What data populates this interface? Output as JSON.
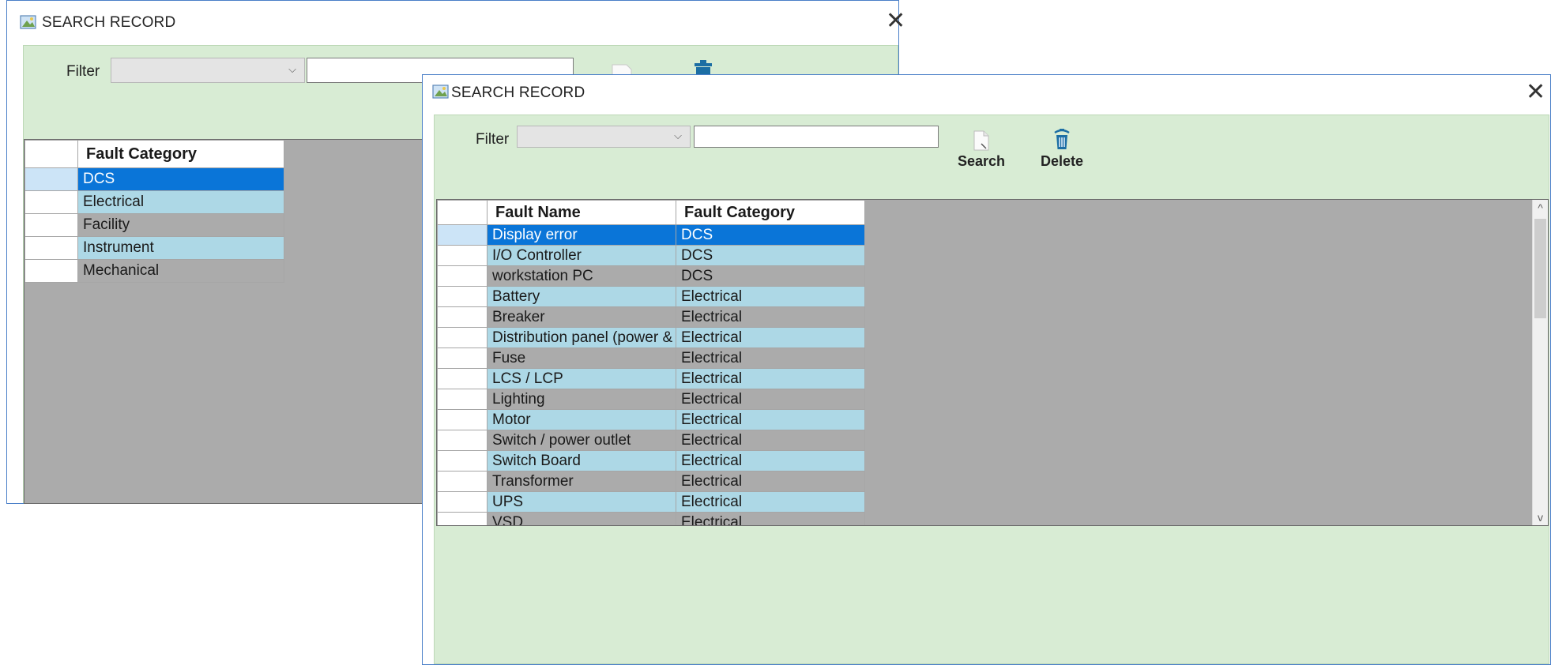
{
  "back_window": {
    "title": "SEARCH RECORD",
    "close_glyph": "✕",
    "filter_label": "Filter",
    "filter_select_value": "",
    "filter_text_value": "",
    "dropdown_glyph": "⌵",
    "grid": {
      "columns": [
        "Fault Category"
      ],
      "rows": [
        {
          "cells": [
            "DCS"
          ],
          "style": "sel"
        },
        {
          "cells": [
            "Electrical"
          ],
          "style": "alt"
        },
        {
          "cells": [
            "Facility"
          ],
          "style": "norm"
        },
        {
          "cells": [
            "Instrument"
          ],
          "style": "alt"
        },
        {
          "cells": [
            "Mechanical"
          ],
          "style": "norm"
        }
      ]
    }
  },
  "front_window": {
    "title": "SEARCH RECORD",
    "close_glyph": "✕",
    "filter_label": "Filter",
    "filter_select_value": "",
    "filter_text_value": "",
    "dropdown_glyph": "⌵",
    "search_label": "Search",
    "delete_label": "Delete",
    "scroll_up_glyph": "^",
    "scroll_down_glyph": "v",
    "grid": {
      "columns": [
        "Fault Name",
        "Fault Category"
      ],
      "rows": [
        {
          "cells": [
            "Display error",
            "DCS"
          ],
          "style": "sel"
        },
        {
          "cells": [
            "I/O Controller",
            "DCS"
          ],
          "style": "alt"
        },
        {
          "cells": [
            "workstation PC",
            "DCS"
          ],
          "style": "norm"
        },
        {
          "cells": [
            "Battery",
            "Electrical"
          ],
          "style": "alt"
        },
        {
          "cells": [
            "Breaker",
            "Electrical"
          ],
          "style": "norm"
        },
        {
          "cells": [
            "Distribution panel (power &",
            "Electrical"
          ],
          "style": "alt"
        },
        {
          "cells": [
            "Fuse",
            "Electrical"
          ],
          "style": "norm"
        },
        {
          "cells": [
            "LCS / LCP",
            "Electrical"
          ],
          "style": "alt"
        },
        {
          "cells": [
            "Lighting",
            "Electrical"
          ],
          "style": "norm"
        },
        {
          "cells": [
            "Motor",
            "Electrical"
          ],
          "style": "alt"
        },
        {
          "cells": [
            "Switch / power outlet",
            "Electrical"
          ],
          "style": "norm"
        },
        {
          "cells": [
            "Switch Board",
            "Electrical"
          ],
          "style": "alt"
        },
        {
          "cells": [
            "Transformer",
            "Electrical"
          ],
          "style": "norm"
        },
        {
          "cells": [
            "UPS",
            "Electrical"
          ],
          "style": "alt"
        },
        {
          "cells": [
            "VSD",
            "Electrical"
          ],
          "style": "norm"
        }
      ]
    }
  },
  "colors": {
    "panel_bg": "#d8ecd4",
    "selected_row": "#0a75d8",
    "alt_row": "#add8e6",
    "grid_bg": "#ababab",
    "window_border": "#4a7fc8"
  },
  "icons": [
    "window-app-icon",
    "document-search-icon",
    "trash-delete-icon",
    "close-icon",
    "chevron-down-icon"
  ]
}
